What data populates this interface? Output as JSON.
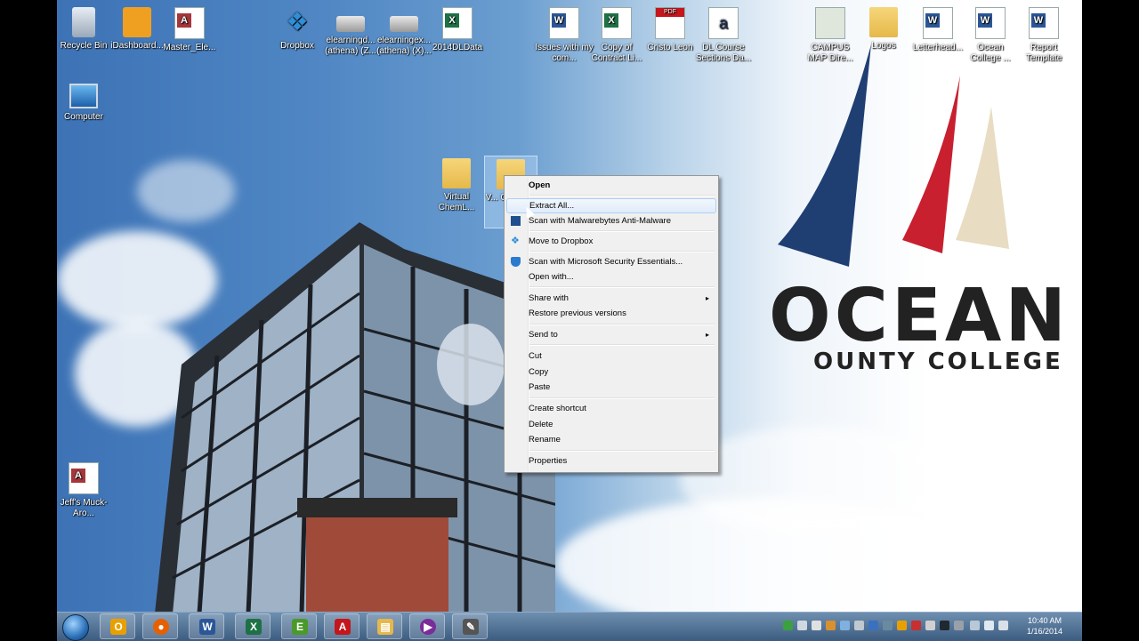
{
  "desktop": {
    "icons": [
      {
        "label": "Recycle Bin",
        "icon": "recycle-bin-icon"
      },
      {
        "label": "iDashboard...",
        "icon": "dashboard-icon"
      },
      {
        "label": "Master_Ele...",
        "icon": "access-file-icon"
      },
      {
        "label": "Dropbox",
        "icon": "dropbox-icon"
      },
      {
        "label": "elearningd... (athena) (Z...",
        "icon": "network-drive-icon"
      },
      {
        "label": "elearningex... (athena) (X)...",
        "icon": "network-drive-icon"
      },
      {
        "label": "2014DLData",
        "icon": "excel-file-icon"
      },
      {
        "label": "Issues with my com...",
        "icon": "word-file-icon"
      },
      {
        "label": "Copy of Contract Li...",
        "icon": "excel-file-icon"
      },
      {
        "label": "Cristo Leon",
        "icon": "pdf-file-icon"
      },
      {
        "label": "DL Course Sections Da...",
        "icon": "text-file-icon"
      },
      {
        "label": "CAMPUS MAP Dire...",
        "icon": "image-file-icon"
      },
      {
        "label": "Logos",
        "icon": "folder-icon"
      },
      {
        "label": "Letterhead...",
        "icon": "word-file-icon"
      },
      {
        "label": "Ocean College ...",
        "icon": "word-file-icon"
      },
      {
        "label": "Report Template",
        "icon": "word-file-icon"
      },
      {
        "label": "Computer",
        "icon": "computer-icon"
      },
      {
        "label": "Virtual ChemL...",
        "icon": "folder-icon"
      },
      {
        "label": "V... Ch... O...",
        "icon": "zip-folder-icon"
      },
      {
        "label": "Jeff's Muck-Aro...",
        "icon": "access-file-icon"
      }
    ],
    "wallpaper": {
      "brand_line1": "OCEAN",
      "brand_line2": "OUNTY COLLEGE"
    }
  },
  "context_menu": {
    "items": [
      {
        "label": "Open",
        "bold": true
      },
      {
        "label": "Extract All...",
        "selected": true
      },
      {
        "label": "Scan with Malwarebytes Anti-Malware",
        "icon": "malwarebytes-icon"
      },
      {
        "label": "Move to Dropbox",
        "icon": "dropbox-icon"
      },
      {
        "label": "Scan with Microsoft Security Essentials...",
        "icon": "security-essentials-icon"
      },
      {
        "label": "Open with..."
      },
      {
        "label": "Share with",
        "submenu": true
      },
      {
        "label": "Restore previous versions"
      },
      {
        "label": "Send to",
        "submenu": true
      },
      {
        "label": "Cut"
      },
      {
        "label": "Copy"
      },
      {
        "label": "Paste"
      },
      {
        "label": "Create shortcut"
      },
      {
        "label": "Delete"
      },
      {
        "label": "Rename"
      },
      {
        "label": "Properties"
      }
    ],
    "submenu_arrow": "▸"
  },
  "taskbar": {
    "apps": [
      {
        "name": "outlook",
        "glyph": "O",
        "color": "#e8a000"
      },
      {
        "name": "firefox",
        "glyph": "●",
        "color": "#e66000"
      },
      {
        "name": "word",
        "glyph": "W",
        "color": "#2b5797"
      },
      {
        "name": "excel",
        "glyph": "X",
        "color": "#1e7145"
      },
      {
        "name": "evernote",
        "glyph": "E",
        "color": "#4a9a2a"
      },
      {
        "name": "acrobat",
        "glyph": "A",
        "color": "#c4161c"
      },
      {
        "name": "explorer",
        "glyph": "▤",
        "color": "#e6b84a"
      },
      {
        "name": "media",
        "glyph": "▶",
        "color": "#7a2d9a"
      },
      {
        "name": "tool",
        "glyph": "✎",
        "color": "#555555"
      }
    ],
    "clock_time": "10:40 AM",
    "clock_date": "1/16/2014"
  }
}
